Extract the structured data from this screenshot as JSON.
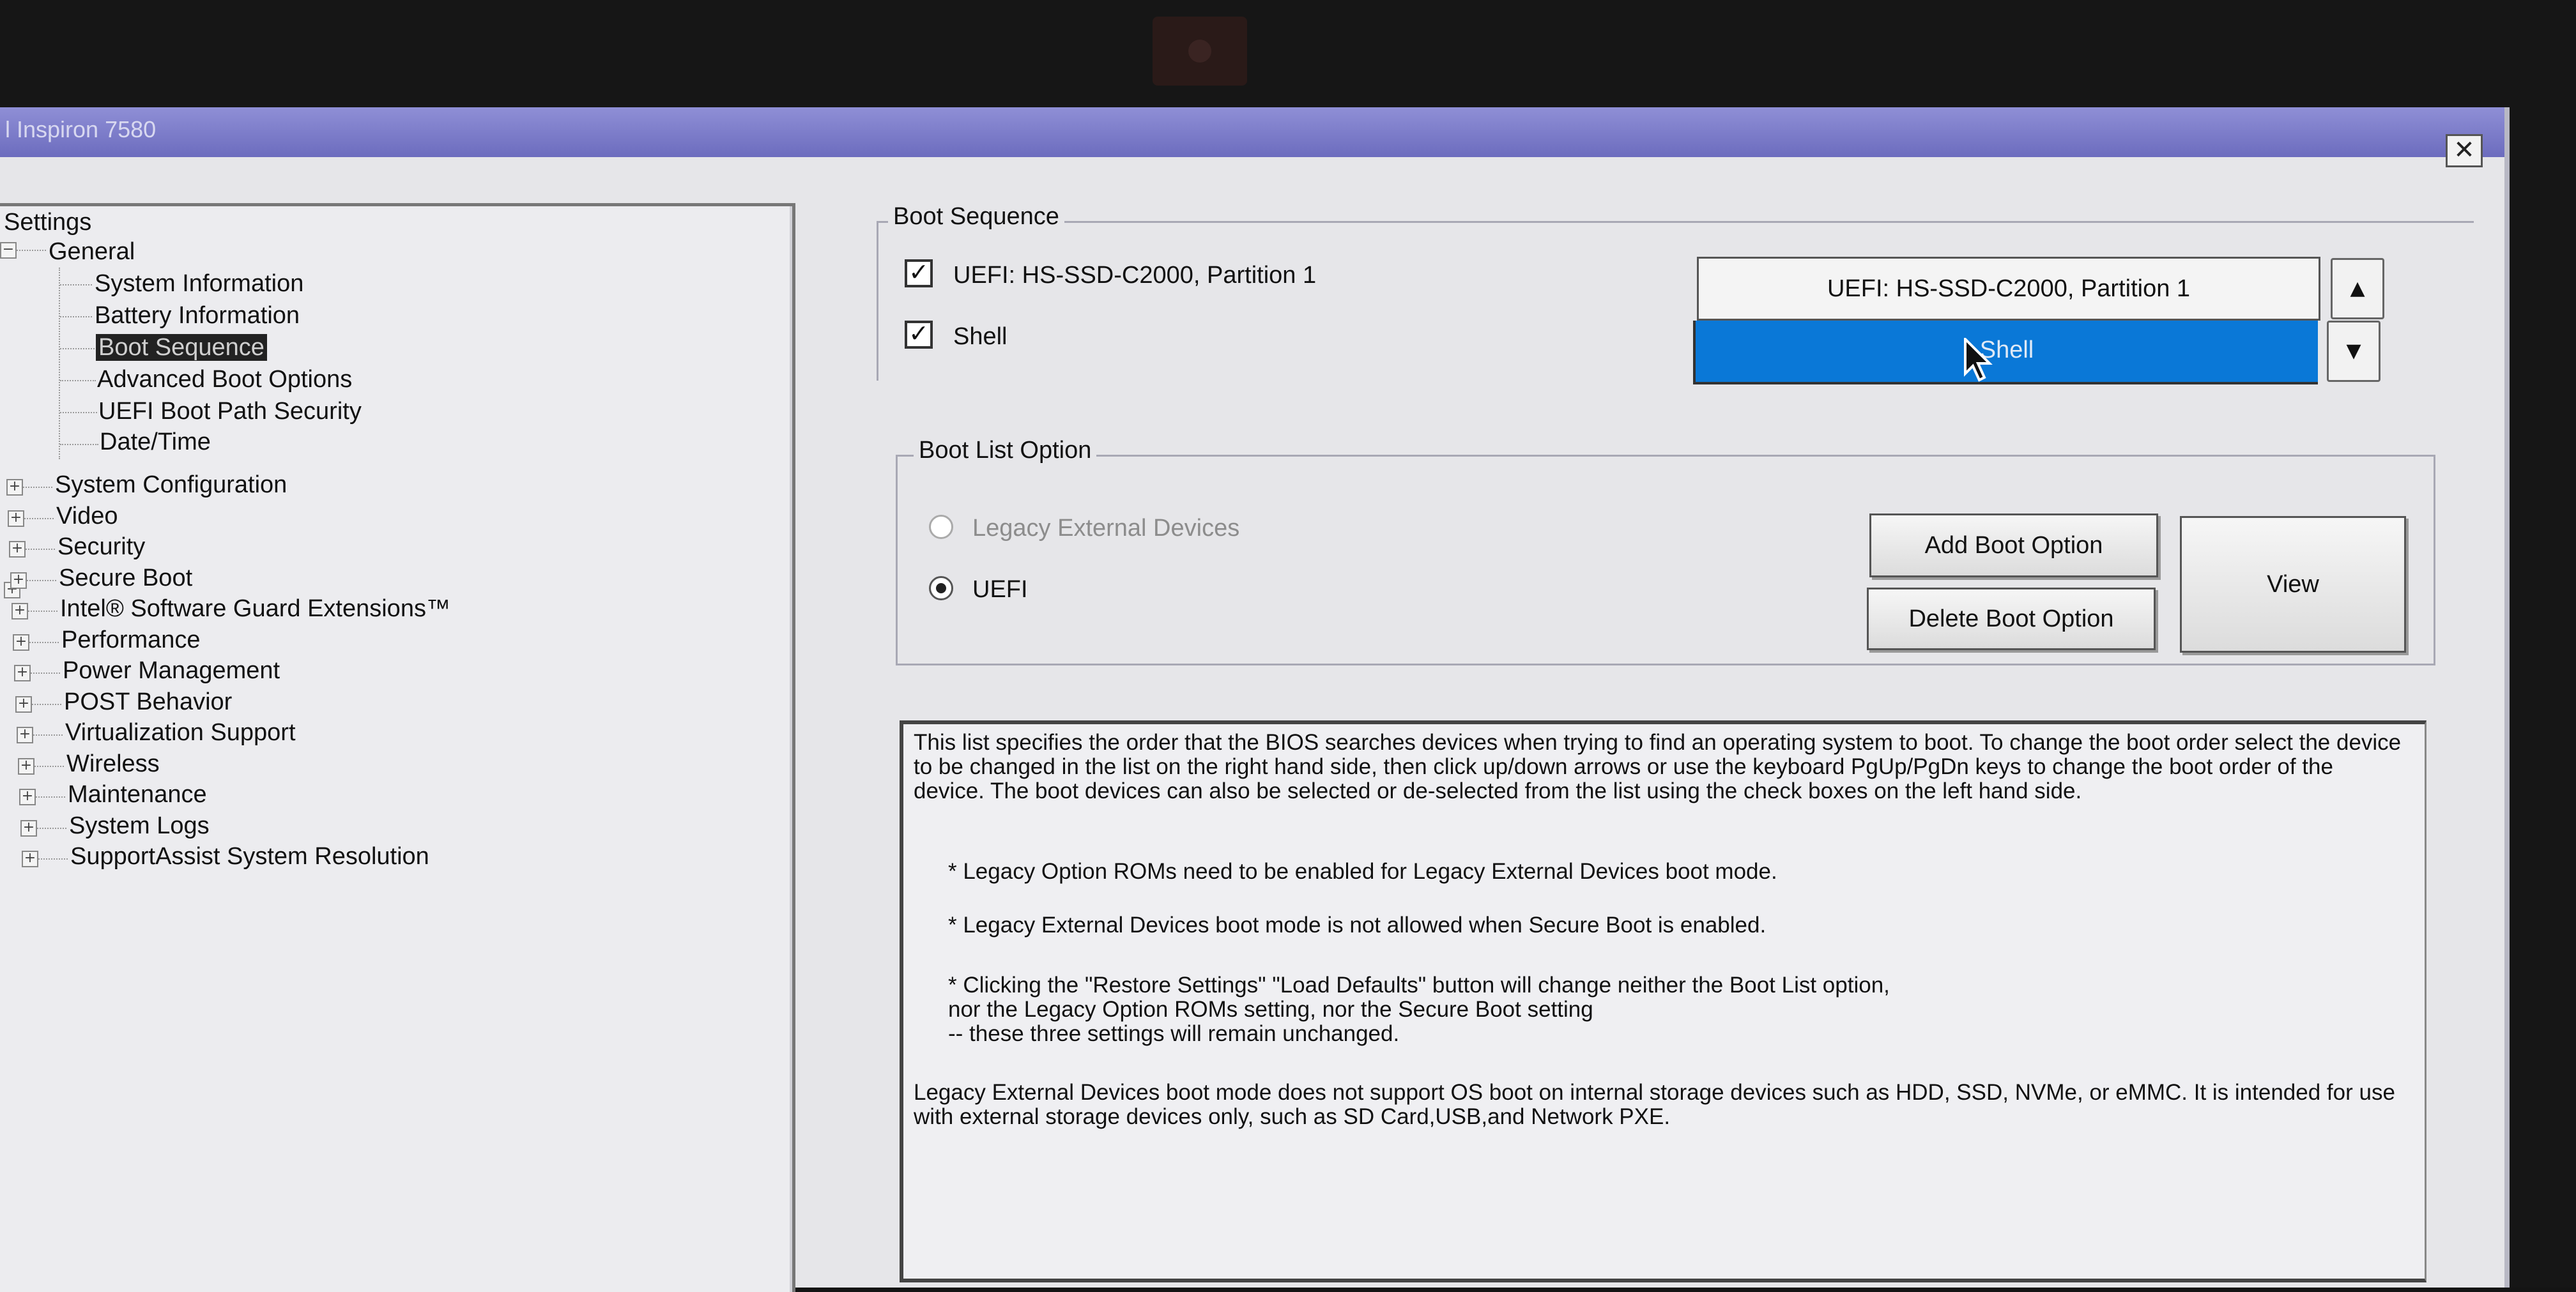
{
  "window": {
    "title": "l Inspiron 7580",
    "close_label": "✕"
  },
  "tree": {
    "root": "Settings",
    "general": "General",
    "general_children": [
      "System Information",
      "Battery Information",
      "Boot Sequence",
      "Advanced Boot Options",
      "UEFI Boot Path Security",
      "Date/Time"
    ],
    "selected": "Boot Sequence",
    "sections": [
      "System Configuration",
      "Video",
      "Security",
      "Secure Boot",
      "Intel® Software Guard Extensions™",
      "Performance",
      "Power Management",
      "POST Behavior",
      "Virtualization Support",
      "Wireless",
      "Maintenance",
      "System Logs",
      "SupportAssist System Resolution"
    ]
  },
  "boot_sequence": {
    "legend": "Boot Sequence",
    "checkboxes": [
      {
        "label": "UEFI: HS-SSD-C2000, Partition 1",
        "checked": true
      },
      {
        "label": "Shell",
        "checked": true
      }
    ],
    "order_list": [
      {
        "label": "UEFI: HS-SSD-C2000, Partition 1",
        "selected": false
      },
      {
        "label": "Shell",
        "selected": true
      }
    ],
    "up_icon": "up-arrow-icon",
    "down_icon": "down-arrow-icon"
  },
  "boot_list_option": {
    "legend": "Boot List Option",
    "options": [
      {
        "label": "Legacy External Devices",
        "selected": false,
        "enabled": false
      },
      {
        "label": "UEFI",
        "selected": true,
        "enabled": true
      }
    ],
    "add_button": "Add Boot Option",
    "delete_button": "Delete Boot Option",
    "view_button": "View"
  },
  "help": {
    "intro": "This list specifies the order that the BIOS searches devices when trying to find an operating system to boot. To change the boot order select the device to be changed in the list on the right hand side, then click up/down arrows or use the keyboard PgUp/PgDn keys to change the boot order of the device. The boot devices can also be selected or de-selected from the list using the check boxes on the left hand side.",
    "notes": [
      "* Legacy Option ROMs need to be enabled for Legacy External Devices boot mode.",
      "* Legacy External Devices boot mode is not allowed when Secure Boot is enabled.",
      "* Clicking the \"Restore Settings\" \"Load Defaults\" button will change neither the Boot List option,\n   nor the Legacy Option ROMs setting, nor the Secure Boot setting\n   -- these three settings will remain unchanged."
    ],
    "footer": "Legacy External Devices boot mode does not support OS boot on internal storage devices such as HDD, SSD, NVMe, or eMMC. It is intended for use with external storage devices only, such as SD Card,USB,and Network PXE."
  },
  "colors": {
    "selection_blue": "#0a78d7",
    "titlebar": "#7a7ac6",
    "window_bg": "#e6e6e9"
  }
}
